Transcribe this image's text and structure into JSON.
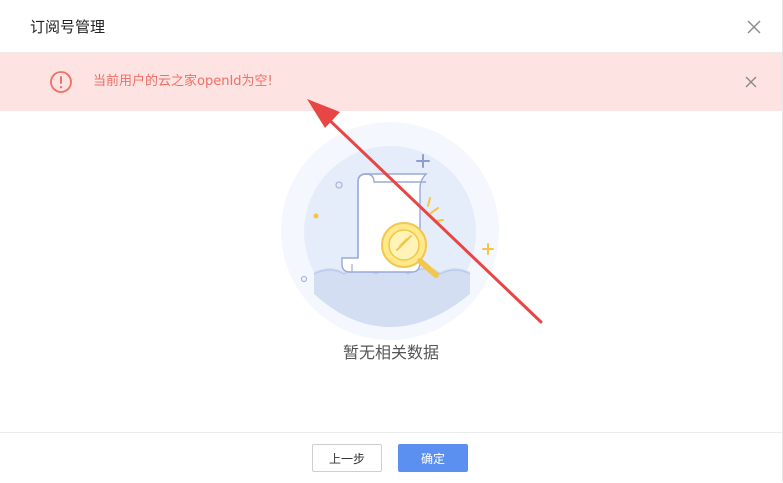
{
  "dialog": {
    "title": "订阅号管理"
  },
  "alert": {
    "message": "当前用户的云之家openId为空!",
    "color": "#f06f66",
    "background": "#fde3e1"
  },
  "empty_state": {
    "text": "暂无相关数据"
  },
  "footer": {
    "prev_label": "上一步",
    "confirm_label": "确定",
    "confirm_color": "#5b8ff0"
  },
  "annotation": {
    "arrow_color": "#e84545"
  }
}
